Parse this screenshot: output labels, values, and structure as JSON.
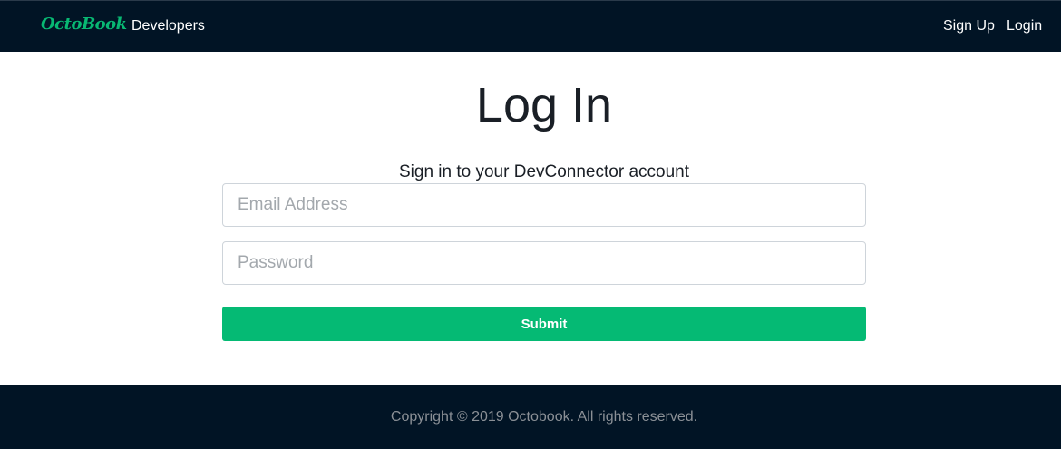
{
  "navbar": {
    "brand": "OctoBook",
    "links": {
      "developers": "Developers",
      "signup": "Sign Up",
      "login": "Login"
    }
  },
  "login": {
    "title": "Log In",
    "subtitle": "Sign in to your DevConnector account",
    "email_placeholder": "Email Address",
    "password_placeholder": "Password",
    "submit_label": "Submit"
  },
  "footer": {
    "copyright": "Copyright © 2019 Octobook. All rights reserved."
  },
  "colors": {
    "navbar_bg": "#011425",
    "brand": "#08b873",
    "accent": "#05ba74",
    "text": "#1a1f26",
    "footer_text": "#8b9096"
  }
}
